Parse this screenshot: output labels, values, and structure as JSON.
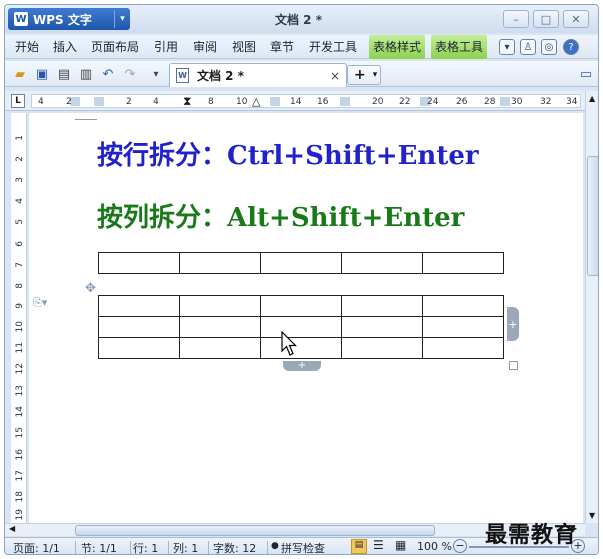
{
  "app": {
    "name": "WPS 文字",
    "doc_title": "文档 2 *"
  },
  "window_controls": {
    "minimize": "–",
    "maximize": "□",
    "close": "✕"
  },
  "menu": {
    "items": [
      "开始",
      "插入",
      "页面布局",
      "引用",
      "审阅",
      "视图",
      "章节",
      "开发工具"
    ],
    "highlighted": [
      "表格样式",
      "表格工具"
    ]
  },
  "doc_tab": {
    "label": "文档 2 *",
    "close": "×",
    "new_tab": "+"
  },
  "ruler": {
    "corner": "L",
    "h_numbers": [
      "4",
      "2",
      "2",
      "4",
      "8",
      "10",
      "14",
      "16",
      "20",
      "22",
      "24",
      "26",
      "28",
      "30",
      "32",
      "34"
    ],
    "v_numbers": [
      "1",
      "2",
      "3",
      "4",
      "5",
      "6",
      "7",
      "8",
      "9",
      "10",
      "11",
      "12",
      "13",
      "14",
      "15",
      "16",
      "17",
      "18",
      "19"
    ]
  },
  "content": {
    "line1": "按行拆分：Ctrl+Shift+Enter",
    "line2": "按列拆分：Alt+Shift+Enter"
  },
  "status": {
    "page": "页面: 1/1",
    "section": "节: 1/1",
    "row": "行: 1",
    "col": "列: 1",
    "chars": "字数: 12",
    "spell": "拼写检查",
    "zoom": "100 %"
  },
  "watermark": "最需教育",
  "colors": {
    "line1": "#2222cc",
    "line2": "#1a7a1a",
    "accent": "#1f56ab",
    "highlight_tab": "#8bd24e"
  }
}
